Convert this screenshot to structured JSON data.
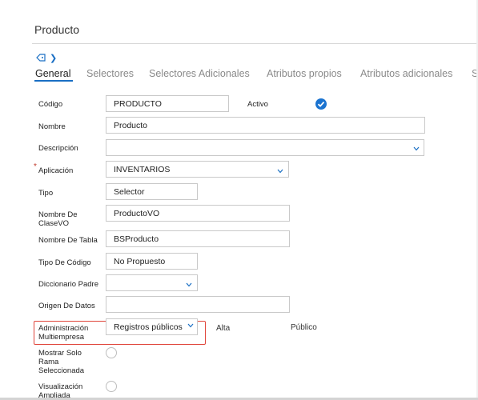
{
  "page": {
    "title": "Producto"
  },
  "tabs": [
    {
      "label": "General"
    },
    {
      "label": "Selectores"
    },
    {
      "label": "Selectores Adicionales"
    },
    {
      "label": "Atributos propios"
    },
    {
      "label": "Atributos adicionales"
    },
    {
      "label": "S"
    }
  ],
  "form": {
    "codigo": {
      "label": "Código",
      "value": "PRODUCTO"
    },
    "activo": {
      "label": "Activo",
      "checked": true
    },
    "nombre": {
      "label": "Nombre",
      "value": "Producto"
    },
    "descripcion": {
      "label": "Descripción",
      "value": ""
    },
    "aplicacion": {
      "label": "Aplicación",
      "required_mark": "*",
      "value": "INVENTARIOS"
    },
    "tipo": {
      "label": "Tipo",
      "value": "Selector"
    },
    "nombre_clase_vo": {
      "label_line1": "Nombre De",
      "label_line2": "ClaseVO",
      "value": "ProductoVO"
    },
    "nombre_tabla": {
      "label": "Nombre De Tabla",
      "value": "BSProducto"
    },
    "tipo_codigo": {
      "label": "Tipo De Código",
      "value": "No Propuesto"
    },
    "diccionario_padre": {
      "label": "Diccionario Padre",
      "value": ""
    },
    "origen_datos": {
      "label": "Origen De Datos",
      "value": ""
    },
    "admin_multiempresa": {
      "label_line1": "Administración",
      "label_line2": "Multiempresa",
      "value": "Registros públicos",
      "alta": "Alta",
      "publico": "Público"
    },
    "mostrar_solo_rama": {
      "label_line1": "Mostrar Solo",
      "label_line2": "Rama",
      "label_line3": "Seleccionada"
    },
    "visualizacion_ampliada": {
      "label_line1": "Visualización",
      "label_line2": "Ampliada"
    }
  },
  "colors": {
    "accent": "#1a6fc4",
    "highlight": "#e0453b",
    "required": "#c0392b"
  }
}
